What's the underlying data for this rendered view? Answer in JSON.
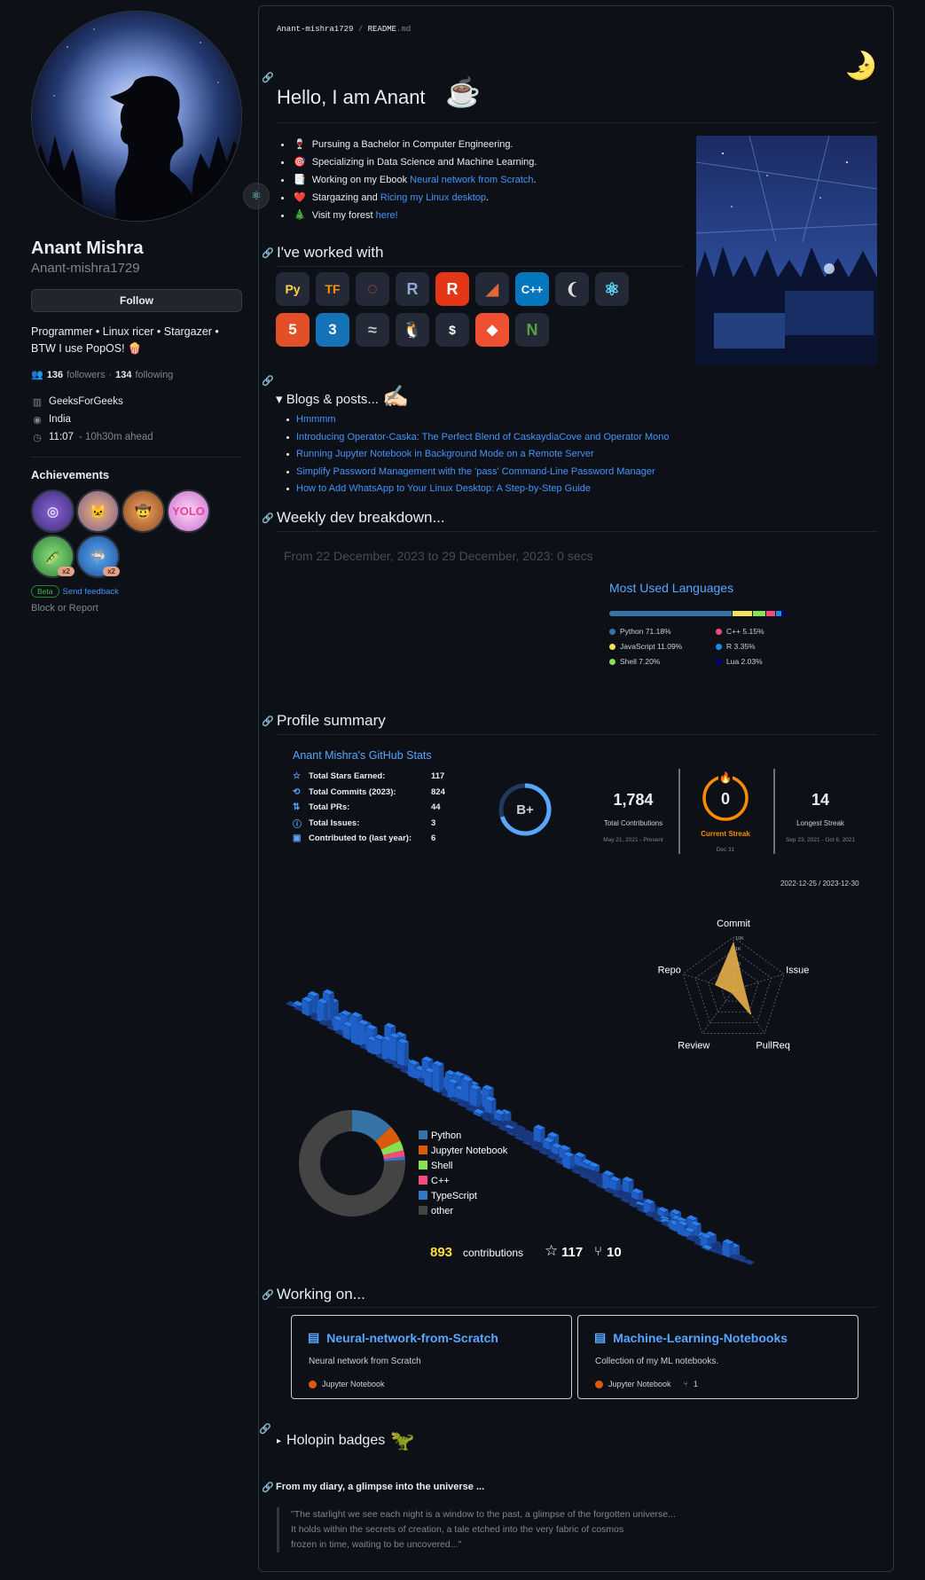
{
  "sidebar": {
    "name": "Anant Mishra",
    "login": "Anant-mishra1729",
    "follow_label": "Follow",
    "bio_line1": "Programmer • Linux ricer • Stargazer •",
    "bio_line2": "BTW I use PopOS! 🍿",
    "followers": "136",
    "followers_label": "followers",
    "following": "134",
    "following_label": "following",
    "company": "GeeksForGeeks",
    "location": "India",
    "time": "11:07",
    "time_note": "- 10h30m ahead",
    "achievements_title": "Achievements",
    "beta_label": "Beta",
    "feedback_label": "Send feedback",
    "block_label": "Block or Report",
    "achievements": [
      {
        "name": "galaxy-brain",
        "badge": ""
      },
      {
        "name": "pull-shark-cat",
        "badge": ""
      },
      {
        "name": "quickdraw",
        "badge": ""
      },
      {
        "name": "yolo",
        "badge": ""
      },
      {
        "name": "pair-extraordinaire",
        "badge": "x2"
      },
      {
        "name": "pull-shark",
        "badge": "x2"
      }
    ]
  },
  "readme": {
    "breadcrumb_user": "Anant-mishra1729",
    "breadcrumb_sep": "/",
    "breadcrumb_file_name": "README",
    "breadcrumb_file_ext": ".md",
    "title": "Hello, I am Anant",
    "bullets": [
      {
        "emoji": "🍷",
        "text": "Pursuing a Bachelor in Computer Engineering.",
        "link": "",
        "after": ""
      },
      {
        "emoji": "🎯",
        "text": "Specializing in Data Science and Machine Learning.",
        "link": "",
        "after": ""
      },
      {
        "emoji": "📑",
        "text": "Working on my Ebook ",
        "link": "Neural network from Scratch",
        "after": "."
      },
      {
        "emoji": "❤️",
        "text": "Stargazing and ",
        "link": "Ricing my Linux desktop",
        "after": "."
      },
      {
        "emoji": "🎄",
        "text": "Visit my forest ",
        "link": "here!",
        "after": ""
      }
    ],
    "worked_with_title": "I've worked with",
    "tools": [
      {
        "name": "python",
        "label": "Py",
        "bg": "#3776ab"
      },
      {
        "name": "tensorflow",
        "label": "TF",
        "bg": "#242938"
      },
      {
        "name": "pytorch",
        "label": "◌",
        "bg": "#242938"
      },
      {
        "name": "r-lang",
        "label": "R",
        "bg": "#242938"
      },
      {
        "name": "rust",
        "label": "R",
        "bg": "#e43717"
      },
      {
        "name": "matlab",
        "label": "◢",
        "bg": "#242938"
      },
      {
        "name": "cpp",
        "label": "C++",
        "bg": "#0277bd"
      },
      {
        "name": "bash-shell",
        "label": "❨",
        "bg": "#242938"
      },
      {
        "name": "react",
        "label": "⚛",
        "bg": "#242938"
      },
      {
        "name": "html5",
        "label": "5",
        "bg": "#e34f26"
      },
      {
        "name": "css3",
        "label": "3",
        "bg": "#1572b6"
      },
      {
        "name": "mysql",
        "label": "≈",
        "bg": "#242938"
      },
      {
        "name": "linux",
        "label": "🐧",
        "bg": "#242938"
      },
      {
        "name": "terminal",
        "label": "$",
        "bg": "#242938"
      },
      {
        "name": "git",
        "label": "◆",
        "bg": "#f05032"
      },
      {
        "name": "neovim",
        "label": "N",
        "bg": "#242938"
      }
    ],
    "blogs_title": "Blogs & posts...",
    "blogs": [
      "Hmmmm",
      "Introducing Operator-Caska: The Perfect Blend of CaskaydiaCove and Operator Mono",
      "Running Jupyter Notebook in Background Mode on a Remote Server",
      "Simplify Password Management with the 'pass' Command-Line Password Manager",
      "How to Add WhatsApp to Your Linux Desktop: A Step-by-Step Guide"
    ],
    "weekly_title": "Weekly dev breakdown...",
    "weekly_range": "From 22 December, 2023 to 29 December, 2023: 0 secs",
    "languages_title": "Most Used Languages",
    "languages": [
      {
        "name": "Python",
        "percent": 71.18,
        "label": "Python 71.18%",
        "color": "#3572a5"
      },
      {
        "name": "C++",
        "percent": 5.15,
        "label": "C++ 5.15%",
        "color": "#f34b7d"
      },
      {
        "name": "JavaScript",
        "percent": 11.09,
        "label": "JavaScript 11.09%",
        "color": "#f1e05a"
      },
      {
        "name": "R",
        "percent": 3.35,
        "label": "R 3.35%",
        "color": "#198ce7"
      },
      {
        "name": "Shell",
        "percent": 7.2,
        "label": "Shell 7.20%",
        "color": "#89e051"
      },
      {
        "name": "Lua",
        "percent": 2.03,
        "label": "Lua 2.03%",
        "color": "#000080"
      }
    ],
    "summary_title": "Profile summary",
    "stats_title": "Anant Mishra's GitHub Stats",
    "stats": [
      {
        "icon": "☆",
        "label": "Total Stars Earned:",
        "value": "117"
      },
      {
        "icon": "⟲",
        "label": "Total Commits (2023):",
        "value": "824"
      },
      {
        "icon": "⇅",
        "label": "Total PRs:",
        "value": "44"
      },
      {
        "icon": "ⓘ",
        "label": "Total Issues:",
        "value": "3"
      },
      {
        "icon": "▣",
        "label": "Contributed to (last year):",
        "value": "6"
      }
    ],
    "grade": "B+",
    "grade_progress": 0.7,
    "streak": {
      "total": "1,784",
      "total_label": "Total Contributions",
      "total_range": "May 21, 2021 - Present",
      "current": "0",
      "current_label": "Current Streak",
      "current_date": "Dec 31",
      "longest": "14",
      "longest_label": "Longest Streak",
      "longest_range": "Sep 23, 2021 - Oct 6, 2021"
    },
    "skyline_range": "2022-12-25 / 2023-12-30",
    "radar_labels": [
      "Commit",
      "Issue",
      "PullReq",
      "Review",
      "Repo"
    ],
    "radar_scale": [
      "10K",
      "1K",
      "30"
    ],
    "radar_values": [
      0.88,
      0.2,
      0.55,
      0.05,
      0.35
    ],
    "donut": [
      {
        "name": "Python",
        "value": 13,
        "color": "#3572a5"
      },
      {
        "name": "Jupyter Notebook",
        "value": 5,
        "color": "#da5b0b"
      },
      {
        "name": "Shell",
        "value": 3,
        "color": "#89e051"
      },
      {
        "name": "C++",
        "value": 2,
        "color": "#f34b7d"
      },
      {
        "name": "TypeScript",
        "value": 1,
        "color": "#3178c6"
      },
      {
        "name": "other",
        "value": 76,
        "color": "#444444"
      }
    ],
    "contributions": "893",
    "contributions_label": "contributions",
    "stars": "117",
    "forks": "10",
    "working_title": "Working on...",
    "repos": [
      {
        "name": "Neural-network-from-Scratch",
        "desc": "Neural network from Scratch",
        "lang": "Jupyter Notebook",
        "forks": ""
      },
      {
        "name": "Machine-Learning-Notebooks",
        "desc": "Collection of my ML notebooks.",
        "lang": "Jupyter Notebook",
        "forks": "1"
      }
    ],
    "holopin_title": "Holopin badges",
    "diary_title": "From my diary, a glimpse into the universe ...",
    "quote": [
      "\"The starlight we see each night is a window to the past, a glimpse of the forgotten universe...",
      "It holds within the secrets of creation, a tale etched into the very fabric of cosmos",
      "frozen in time, waiting to be uncovered...\""
    ]
  }
}
